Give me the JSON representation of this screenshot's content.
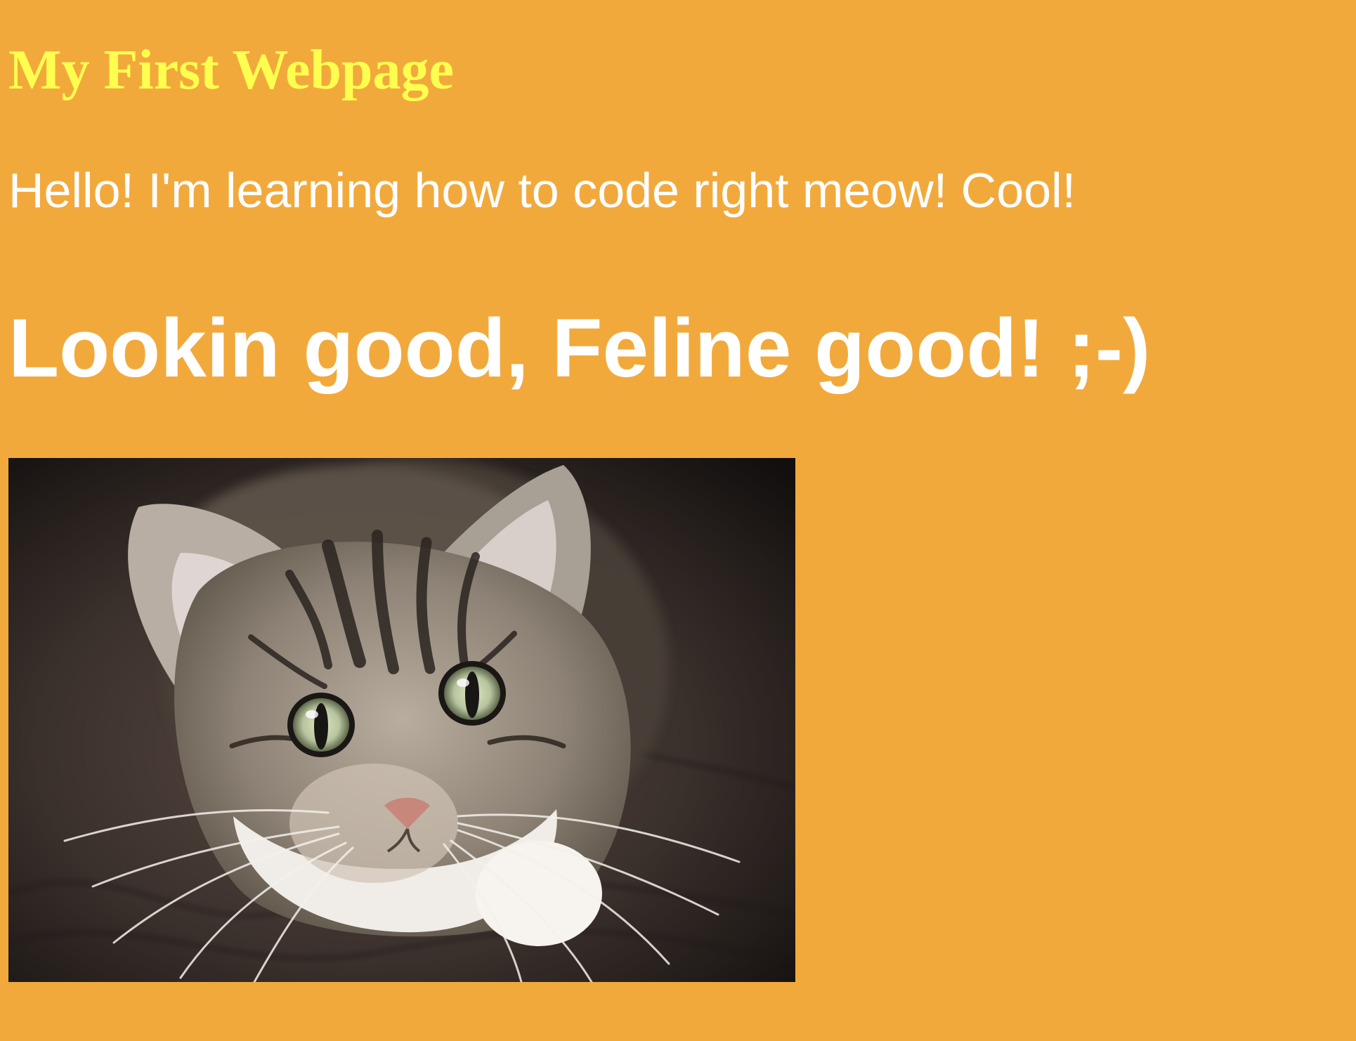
{
  "page": {
    "title": "My First Webpage",
    "intro": "Hello! I'm learning how to code right meow! Cool!",
    "headline": "Lookin good, Feline good! ;-)"
  },
  "image": {
    "subject": "tabby-cat-photo"
  },
  "colors": {
    "background": "#f2a93c",
    "title": "#ffff4f",
    "text": "#ffffff"
  }
}
